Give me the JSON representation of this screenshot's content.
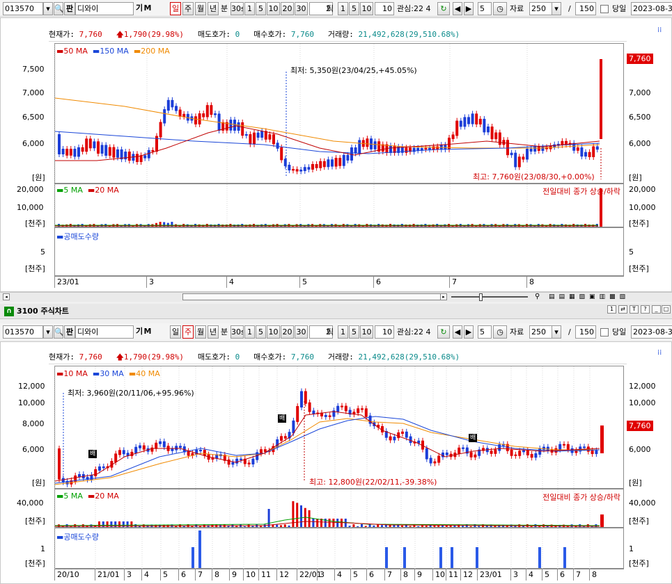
{
  "toolbar": {
    "code": "013570",
    "name": "디와이",
    "ki": "기",
    "m": "M",
    "periods": [
      "일",
      "주",
      "월",
      "년"
    ],
    "bun": "분",
    "minutes": [
      "30s",
      "1",
      "5",
      "10",
      "20",
      "30"
    ],
    "tick_count": "2",
    "tick_label": "틱",
    "ticks": [
      "1",
      "5",
      "10"
    ],
    "tick_input": "10",
    "interest": "관심:22 4",
    "count": "5",
    "data_label": "자료",
    "data_count": "250",
    "slash": "/",
    "max_count": "150",
    "today": "당일",
    "date": "2023-08-3"
  },
  "top_window": {
    "selected_period": "일",
    "info": {
      "price_label": "현재가:",
      "price": "7,760",
      "change": "1,790(29.98%)",
      "bid_label": "매도호가:",
      "bid": "0",
      "ask_label": "매수호가:",
      "ask": "7,760",
      "volume_label": "거래량:",
      "volume": "21,492,628(29,510.68%)"
    },
    "legend_ma": [
      "50 MA",
      "150 MA",
      "200 MA"
    ],
    "legend_vol": [
      "5 MA",
      "20 MA"
    ],
    "legend_short": "공매도수량",
    "vol_note": "전일대비 종가 상승/하락",
    "low_note": "최저: 5,350원(23/04/25,+45.05%)",
    "high_note": "최고: 7,760원(23/08/30,+0.00%)",
    "price_tag": "7,760",
    "y_price": [
      "7,500",
      "7,000",
      "6,500",
      "6,000"
    ],
    "y_price_unit": "[원]",
    "y_vol": [
      "20,000",
      "10,000"
    ],
    "y_vol_unit": "[천주]",
    "y_short": [
      "5"
    ],
    "y_short_unit": "[천주]",
    "x_labels": [
      "23/01",
      "3",
      "4",
      "5",
      "6",
      "7",
      "8"
    ]
  },
  "bottom_window": {
    "title": "3100 주식차트",
    "selected_period": "주",
    "info": {
      "price_label": "현재가:",
      "price": "7,760",
      "change": "1,790(29.98%)",
      "bid_label": "매도호가:",
      "bid": "0",
      "ask_label": "매수호가:",
      "ask": "7,760",
      "volume_label": "거래량:",
      "volume": "21,492,628(29,510.68%)"
    },
    "legend_ma": [
      "10 MA",
      "30 MA",
      "40 MA"
    ],
    "legend_vol": [
      "5 MA",
      "20 MA"
    ],
    "legend_short": "공매도수량",
    "vol_note": "전일대비 종가 상승/하락",
    "low_note": "최저: 3,960원(20/11/06,+95.96%)",
    "high_note": "최고: 12,800원(22/02/11,-39.38%)",
    "price_tag": "7,760",
    "y_price": [
      "12,000",
      "10,000",
      "8,000",
      "6,000"
    ],
    "y_price_unit": "[원]",
    "y_vol": [
      "40,000"
    ],
    "y_vol_unit": "[천주]",
    "y_short": [
      "1"
    ],
    "y_short_unit": "[천주]",
    "x_labels": [
      "20/10",
      "21/01",
      "3",
      "4",
      "5",
      "6",
      "7",
      "8",
      "9",
      "10",
      "11",
      "12",
      "22/01",
      "3",
      "4",
      "5",
      "6",
      "7",
      "8",
      "9",
      "10",
      "11",
      "12",
      "23/01",
      "3",
      "4",
      "5",
      "6",
      "7",
      "8"
    ],
    "markers": [
      "배",
      "배",
      "배"
    ]
  },
  "colors": {
    "up": "#e00000",
    "down": "#1c3ed8",
    "ma_short": "#c00000",
    "ma_mid": "#1a46d8",
    "ma_long": "#f08a00",
    "vol_ma5": "#00a000"
  }
}
